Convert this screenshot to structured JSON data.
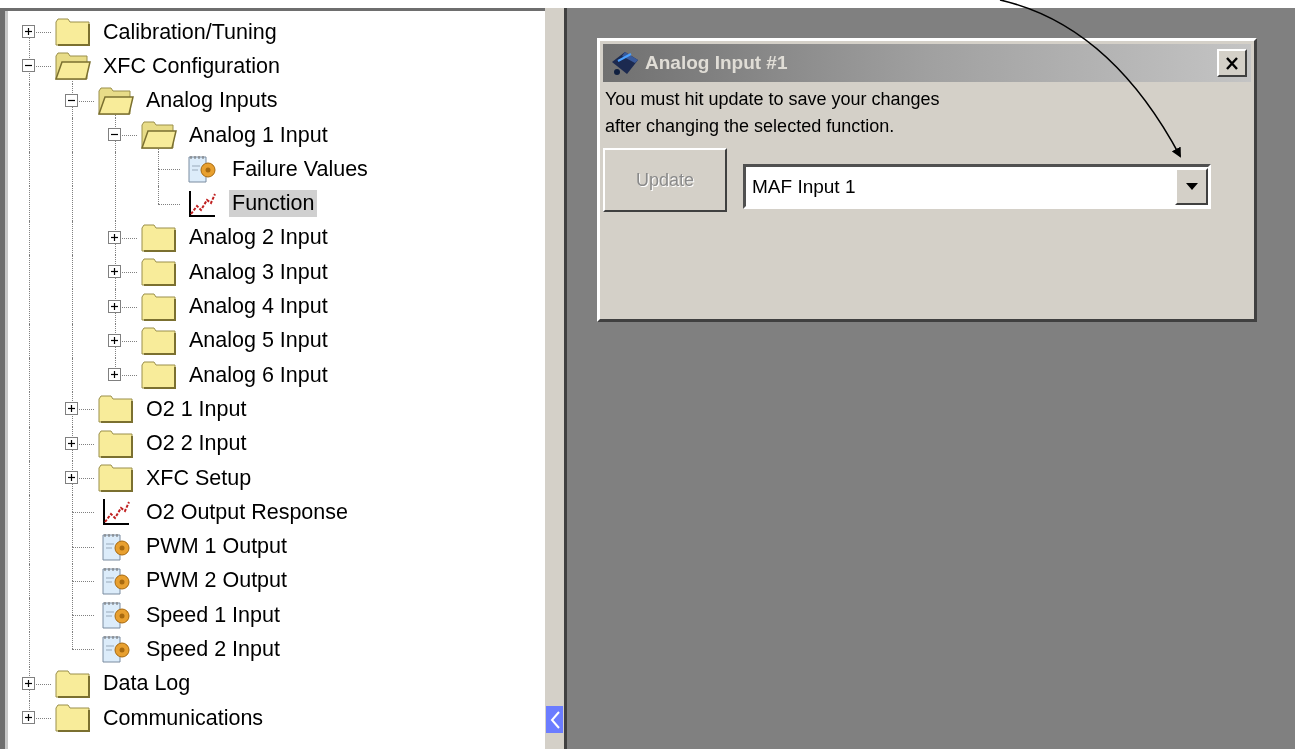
{
  "tree": [
    {
      "label": "Calibration/Tuning",
      "kind": "folder",
      "expanded": false,
      "selected": false
    },
    {
      "label": "XFC Configuration",
      "kind": "folder",
      "expanded": true,
      "selected": false,
      "children": [
        {
          "label": "Analog Inputs",
          "kind": "folder",
          "expanded": true,
          "selected": false,
          "children": [
            {
              "label": "Analog 1 Input",
              "kind": "folder",
              "expanded": true,
              "selected": false,
              "children": [
                {
                  "label": "Failure Values",
                  "kind": "settings",
                  "selected": false
                },
                {
                  "label": "Function",
                  "kind": "chart",
                  "selected": true
                }
              ]
            },
            {
              "label": "Analog 2 Input",
              "kind": "folder",
              "expanded": false,
              "selected": false
            },
            {
              "label": "Analog 3 Input",
              "kind": "folder",
              "expanded": false,
              "selected": false
            },
            {
              "label": "Analog 4 Input",
              "kind": "folder",
              "expanded": false,
              "selected": false
            },
            {
              "label": "Analog 5 Input",
              "kind": "folder",
              "expanded": false,
              "selected": false
            },
            {
              "label": "Analog 6 Input",
              "kind": "folder",
              "expanded": false,
              "selected": false
            }
          ]
        },
        {
          "label": "O2 1 Input",
          "kind": "folder",
          "expanded": false,
          "selected": false
        },
        {
          "label": "O2 2 Input",
          "kind": "folder",
          "expanded": false,
          "selected": false
        },
        {
          "label": "XFC Setup",
          "kind": "folder",
          "expanded": false,
          "selected": false
        },
        {
          "label": "O2 Output Response",
          "kind": "chart",
          "selected": false
        },
        {
          "label": "PWM 1 Output",
          "kind": "settings",
          "selected": false
        },
        {
          "label": "PWM 2 Output",
          "kind": "settings",
          "selected": false
        },
        {
          "label": "Speed 1 Input",
          "kind": "settings",
          "selected": false
        },
        {
          "label": "Speed 2 Input",
          "kind": "settings",
          "selected": false
        }
      ]
    },
    {
      "label": "Data Log",
      "kind": "folder",
      "expanded": false,
      "selected": false
    },
    {
      "label": "Communications",
      "kind": "folder",
      "expanded": false,
      "selected": false
    }
  ],
  "dialog": {
    "title": "Analog Input #1",
    "message": [
      "You must hit update to save your changes",
      "after changing the selected function."
    ],
    "update_button": {
      "label": "Update",
      "disabled": true
    },
    "function_select": {
      "value": "MAF Input 1"
    }
  }
}
